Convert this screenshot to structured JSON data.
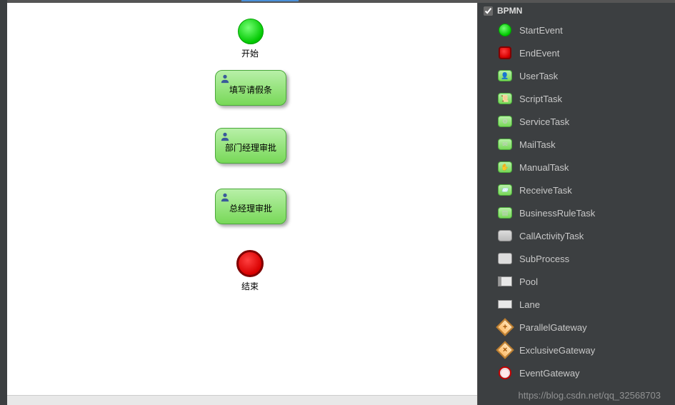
{
  "palette": {
    "title": "BPMN",
    "checked": true,
    "items": [
      {
        "label": "StartEvent",
        "icon": "start-event-icon"
      },
      {
        "label": "EndEvent",
        "icon": "end-event-icon"
      },
      {
        "label": "UserTask",
        "icon": "user-task-icon"
      },
      {
        "label": "ScriptTask",
        "icon": "script-task-icon"
      },
      {
        "label": "ServiceTask",
        "icon": "service-task-icon"
      },
      {
        "label": "MailTask",
        "icon": "mail-task-icon"
      },
      {
        "label": "ManualTask",
        "icon": "manual-task-icon"
      },
      {
        "label": "ReceiveTask",
        "icon": "receive-task-icon"
      },
      {
        "label": "BusinessRuleTask",
        "icon": "business-rule-task-icon"
      },
      {
        "label": "CallActivityTask",
        "icon": "call-activity-task-icon"
      },
      {
        "label": "SubProcess",
        "icon": "subprocess-icon"
      },
      {
        "label": "Pool",
        "icon": "pool-icon"
      },
      {
        "label": "Lane",
        "icon": "lane-icon"
      },
      {
        "label": "ParallelGateway",
        "icon": "parallel-gateway-icon"
      },
      {
        "label": "ExclusiveGateway",
        "icon": "exclusive-gateway-icon"
      },
      {
        "label": "EventGateway",
        "icon": "event-gateway-icon"
      }
    ]
  },
  "canvas": {
    "start_label": "开始",
    "task1_label": "填写请假条",
    "task2_label": "部门经理审批",
    "task3_label": "总经理审批",
    "end_label": "结束"
  },
  "watermark": "https://blog.csdn.net/qq_32568703"
}
